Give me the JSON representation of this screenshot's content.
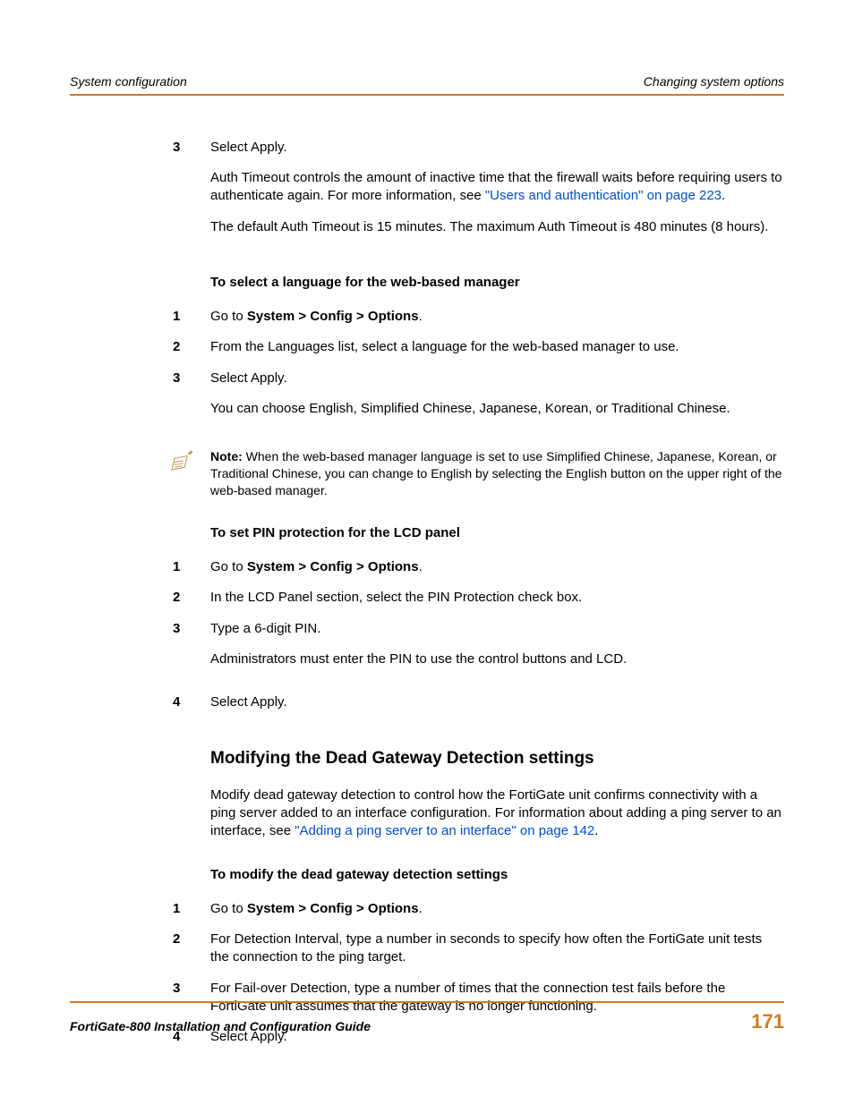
{
  "header": {
    "left": "System configuration",
    "right": "Changing system options"
  },
  "sec_a": {
    "step3": "Select Apply.",
    "p1_a": "Auth Timeout controls the amount of inactive time that the firewall waits before requiring users to authenticate again. For more information, see ",
    "p1_link": "\"Users and authentication\" on page 223",
    "p1_b": ".",
    "p2": "The default Auth Timeout is 15 minutes. The maximum Auth Timeout is 480 minutes (8 hours)."
  },
  "sec_lang": {
    "title": "To select a language for the web-based manager",
    "s1_a": "Go to ",
    "s1_b": "System > Config > Options",
    "s1_c": ".",
    "s2": "From the Languages list, select a language for the web-based manager to use.",
    "s3": "Select Apply.",
    "p1": "You can choose English, Simplified Chinese, Japanese, Korean, or Traditional Chinese."
  },
  "note": {
    "label": "Note:",
    "text": " When the web-based manager language is set to use Simplified Chinese, Japanese, Korean, or Traditional Chinese, you can change to English by selecting the English button on the upper right of the web-based manager."
  },
  "sec_pin": {
    "title": "To set PIN protection for the LCD panel",
    "s1_a": "Go to ",
    "s1_b": "System > Config > Options",
    "s1_c": ".",
    "s2": "In the LCD Panel section, select the PIN Protection check box.",
    "s3": "Type a 6-digit PIN.",
    "p1": "Administrators must enter the PIN to use the control buttons and LCD.",
    "s4": "Select Apply."
  },
  "sec_dg": {
    "heading": "Modifying the Dead Gateway Detection settings",
    "intro_a": "Modify dead gateway detection to control how the FortiGate unit confirms connectivity with a ping server added to an interface configuration. For information about adding a ping server to an interface, see ",
    "intro_link": "\"Adding a ping server to an interface\" on page 142",
    "intro_b": ".",
    "title": "To modify the dead gateway detection settings",
    "s1_a": "Go to ",
    "s1_b": "System > Config > Options",
    "s1_c": ".",
    "s2": "For Detection Interval, type a number in seconds to specify how often the FortiGate unit tests the connection to the ping target.",
    "s3": "For Fail-over Detection, type a number of times that the connection test fails before the FortiGate unit assumes that the gateway is no longer functioning.",
    "s4": "Select Apply."
  },
  "footer": {
    "left": "FortiGate-800 Installation and Configuration Guide",
    "right": "171"
  },
  "nums": {
    "n1": "1",
    "n2": "2",
    "n3": "3",
    "n4": "4"
  }
}
